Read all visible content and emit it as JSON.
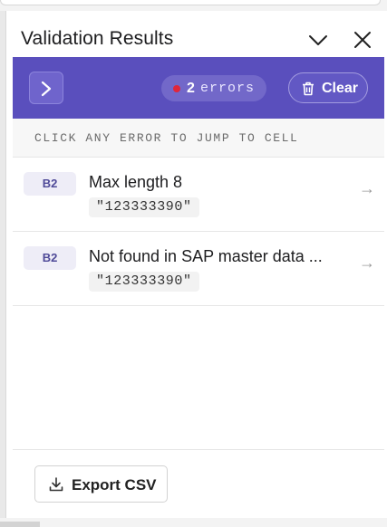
{
  "header": {
    "title": "Validation Results",
    "collapse_icon": "chevron-down-icon",
    "close_icon": "close-icon"
  },
  "toolbar": {
    "nav_icon": "chevron-right-icon",
    "error_count": "2",
    "error_word": "errors",
    "clear_label": "Clear",
    "clear_icon": "trash-icon"
  },
  "hint": "CLICK ANY ERROR TO JUMP TO CELL",
  "errors": [
    {
      "cell": "B2",
      "message": "Max length 8",
      "value": "\"123333390\"",
      "arrow": "→"
    },
    {
      "cell": "B2",
      "message": "Not found in SAP master data ...",
      "value": "\"123333390\"",
      "arrow": "→"
    }
  ],
  "footer": {
    "export_label": "Export CSV",
    "export_icon": "download-icon"
  },
  "colors": {
    "toolbar_bg": "#5a4fbd",
    "error_dot": "#e0263b",
    "badge_text": "#4f4a98"
  }
}
